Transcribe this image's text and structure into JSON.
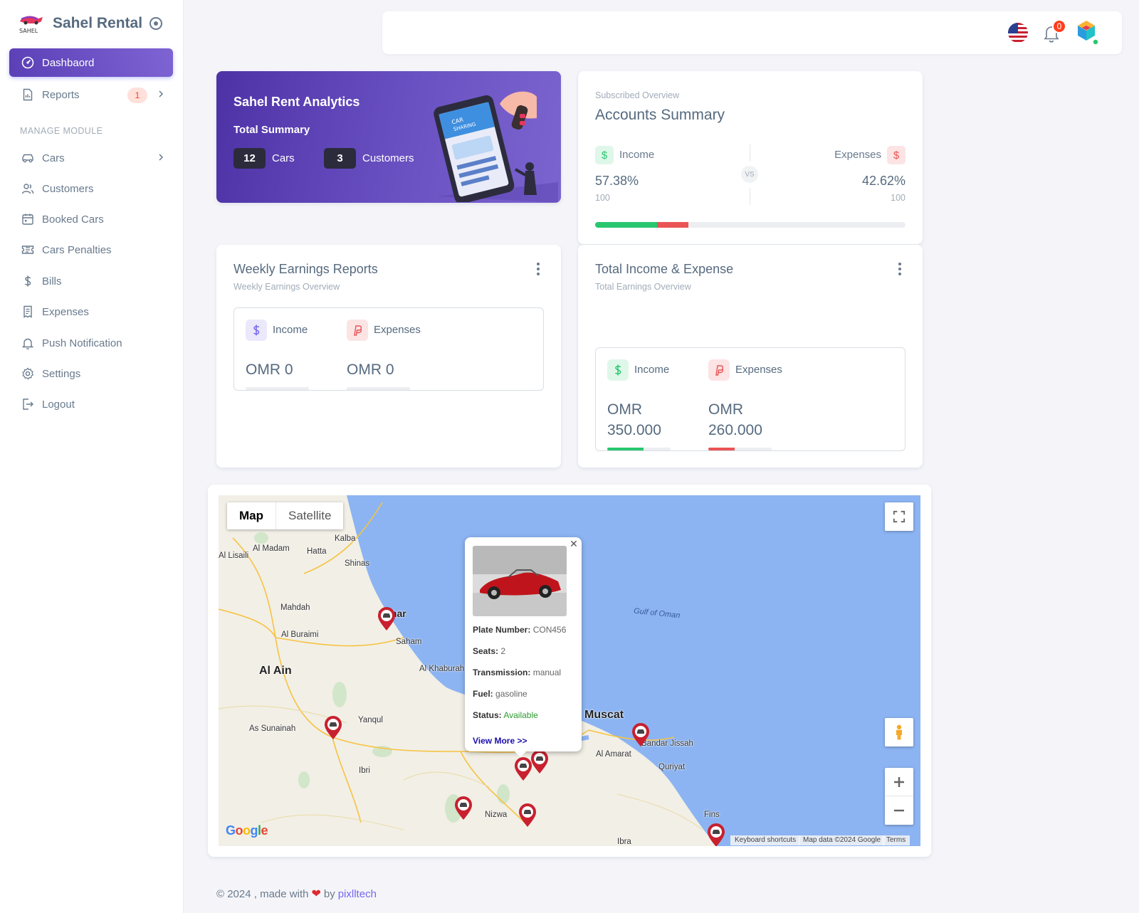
{
  "brand": {
    "name": "Sahel Rental",
    "logo_text": "SAHEL"
  },
  "sidebar": {
    "items_top": [
      {
        "label": "Dashbaord",
        "icon": "dashboard-icon",
        "active": true
      },
      {
        "label": "Reports",
        "icon": "report-icon",
        "badge": "1"
      }
    ],
    "section_header": "MANAGE MODULE",
    "items": [
      {
        "label": "Cars",
        "icon": "car-icon"
      },
      {
        "label": "Customers",
        "icon": "users-icon"
      },
      {
        "label": "Booked Cars",
        "icon": "calendar-icon"
      },
      {
        "label": "Cars Penalties",
        "icon": "ticket-icon"
      },
      {
        "label": "Bills",
        "icon": "dollar-icon"
      },
      {
        "label": "Expenses",
        "icon": "receipt-icon"
      },
      {
        "label": "Push Notification",
        "icon": "bell-icon"
      },
      {
        "label": "Settings",
        "icon": "gear-icon"
      },
      {
        "label": "Logout",
        "icon": "logout-icon"
      }
    ]
  },
  "navbar": {
    "notification_count": "0"
  },
  "analytics": {
    "title": "Sahel Rent Analytics",
    "subtitle": "Total Summary",
    "cars_count": "12",
    "cars_label": "Cars",
    "customers_count": "3",
    "customers_label": "Customers"
  },
  "accounts": {
    "overline": "Subscribed Overview",
    "title": "Accounts Summary",
    "income_label": "Income",
    "income_pct": "57.38%",
    "income_base": "100",
    "expenses_label": "Expenses",
    "expenses_pct": "42.62%",
    "expenses_base": "100",
    "vs": "VS",
    "bar_income_fraction": 0.2,
    "bar_expense_fraction": 0.1
  },
  "weekly": {
    "title": "Weekly Earnings Reports",
    "subtitle": "Weekly Earnings Overview",
    "income_label": "Income",
    "income_value": "OMR 0",
    "expenses_label": "Expenses",
    "expenses_value": "OMR 0"
  },
  "total": {
    "title": "Total Income & Expense",
    "subtitle": "Total Earnings Overview",
    "income_label": "Income",
    "income_currency": "OMR",
    "income_amount": "350.000",
    "expenses_label": "Expenses",
    "expenses_currency": "OMR",
    "expenses_amount": "260.000",
    "income_fill": 0.57,
    "expenses_fill": 0.42
  },
  "map": {
    "type_map": "Map",
    "type_satellite": "Satellite",
    "labels": [
      {
        "text": "Kalba",
        "k": "kalba"
      },
      {
        "text": "Al Madam",
        "k": "almadam"
      },
      {
        "text": "Hatta",
        "k": "hatta"
      },
      {
        "text": "Al Lisaili",
        "k": "lisaili"
      },
      {
        "text": "Shinas",
        "k": "shinas"
      },
      {
        "text": "Mahdah",
        "k": "mahdah"
      },
      {
        "text": "Al Buraimi",
        "k": "buraimi"
      },
      {
        "text": "Saham",
        "k": "saham"
      },
      {
        "text": "Al Khaburah",
        "k": "khaburah"
      },
      {
        "text": "Yanqul",
        "k": "yanqul"
      },
      {
        "text": "As Sunainah",
        "k": "sunainah"
      },
      {
        "text": "Ibri",
        "k": "ibri"
      },
      {
        "text": "Nizwa",
        "k": "nizwa"
      },
      {
        "text": "Bandar Jissah",
        "k": "jissah"
      },
      {
        "text": "Al Amarat",
        "k": "amarat"
      },
      {
        "text": "Quriyat",
        "k": "quriyat"
      },
      {
        "text": "Fins",
        "k": "fins"
      },
      {
        "text": "Ibra",
        "k": "ibra"
      }
    ],
    "big_labels": [
      {
        "text": "Al Ain",
        "k": "alain"
      },
      {
        "text": "Muscat",
        "k": "muscat"
      },
      {
        "text": "Sohar",
        "k": "sohar"
      }
    ],
    "sea_label": "Gulf of Oman",
    "popup": {
      "plate_label": "Plate Number:",
      "plate": "CON456",
      "seats_label": "Seats:",
      "seats": "2",
      "transmission_label": "Transmission:",
      "transmission": "manual",
      "fuel_label": "Fuel:",
      "fuel": "gasoline",
      "status_label": "Status:",
      "status": "Available",
      "link": "View More >>",
      "status_color": "#2e9c2e"
    },
    "google": "Google",
    "attribution": [
      "Keyboard shortcuts",
      "Map data ©2024 Google",
      "Terms"
    ]
  },
  "footer": {
    "text": "© 2024 , made with",
    "by": "by",
    "author": "pixlltech"
  },
  "colors": {
    "primary": "#6a51c2",
    "success": "#28c76f",
    "danger": "#ea5455",
    "water": "#8cb4f2"
  }
}
